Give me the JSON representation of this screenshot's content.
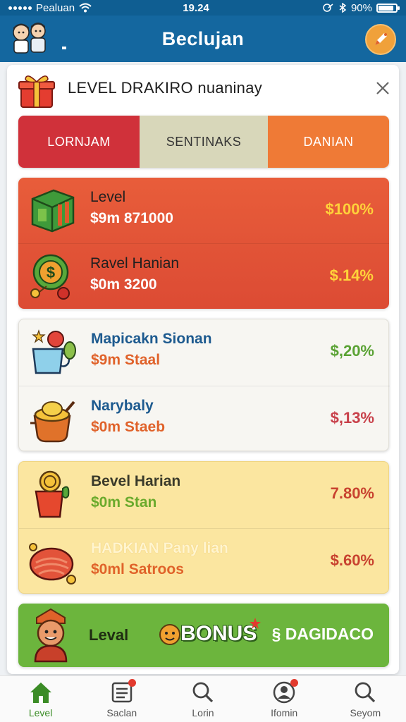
{
  "status_bar": {
    "carrier": "Pealuan",
    "time": "19.24",
    "battery": "90%",
    "battery_level": 0.9
  },
  "header": {
    "title": "Beclujan"
  },
  "card": {
    "title": "LEVEL DRAKIRO nuaninay",
    "tabs": [
      "LORNJAM",
      "SENTINAKS",
      "DANIAN"
    ],
    "groups": [
      {
        "style": "red",
        "rows": [
          {
            "icon": "green-box-icon",
            "title": "Level",
            "sub": "$9m 871000",
            "value": "$100%"
          },
          {
            "icon": "dollar-coin-icon",
            "title": "Ravel Hanian",
            "sub": "$0m 3200",
            "value": "$.14%"
          }
        ]
      },
      {
        "style": "white",
        "rows": [
          {
            "icon": "cup-fruit-icon",
            "title": "Mapicakn Sionan",
            "sub": "$9m Staal",
            "value": "$,20%",
            "value_color": "#5aa234"
          },
          {
            "icon": "cooking-pot-icon",
            "title": "Narybaly",
            "sub": "$0m Staeb",
            "value": "$,13%",
            "value_color": "#c8404a"
          }
        ]
      },
      {
        "style": "yellow",
        "rows": [
          {
            "icon": "coin-bag-icon",
            "title": "Bevel Harian",
            "sub": "$0m Stan",
            "value": "7.80%"
          },
          {
            "icon": "meat-steak-icon",
            "title": "HADKIAN Pany lian",
            "sub": "$0ml Satroos",
            "value": "$.60%"
          }
        ]
      }
    ],
    "bonus": {
      "level_label": "Leval",
      "bonus_label": "BONUS",
      "right_label": "§ DAGIDACO"
    }
  },
  "bottom_nav": [
    {
      "icon": "home-icon",
      "label": "Level",
      "active": true,
      "badge": false
    },
    {
      "icon": "list-icon",
      "label": "Saclan",
      "active": false,
      "badge": true
    },
    {
      "icon": "search-icon",
      "label": "Lorin",
      "active": false,
      "badge": false
    },
    {
      "icon": "profile-icon",
      "label": "Ifomin",
      "active": false,
      "badge": true
    },
    {
      "icon": "search-icon",
      "label": "Seyom",
      "active": false,
      "badge": false
    }
  ],
  "colors": {
    "header_blue": "#14679f",
    "red_group": "#dc4b34",
    "yellow_group": "#fbe6a0",
    "bonus_green": "#6cb53d",
    "value_gold": "#ffd23a"
  }
}
